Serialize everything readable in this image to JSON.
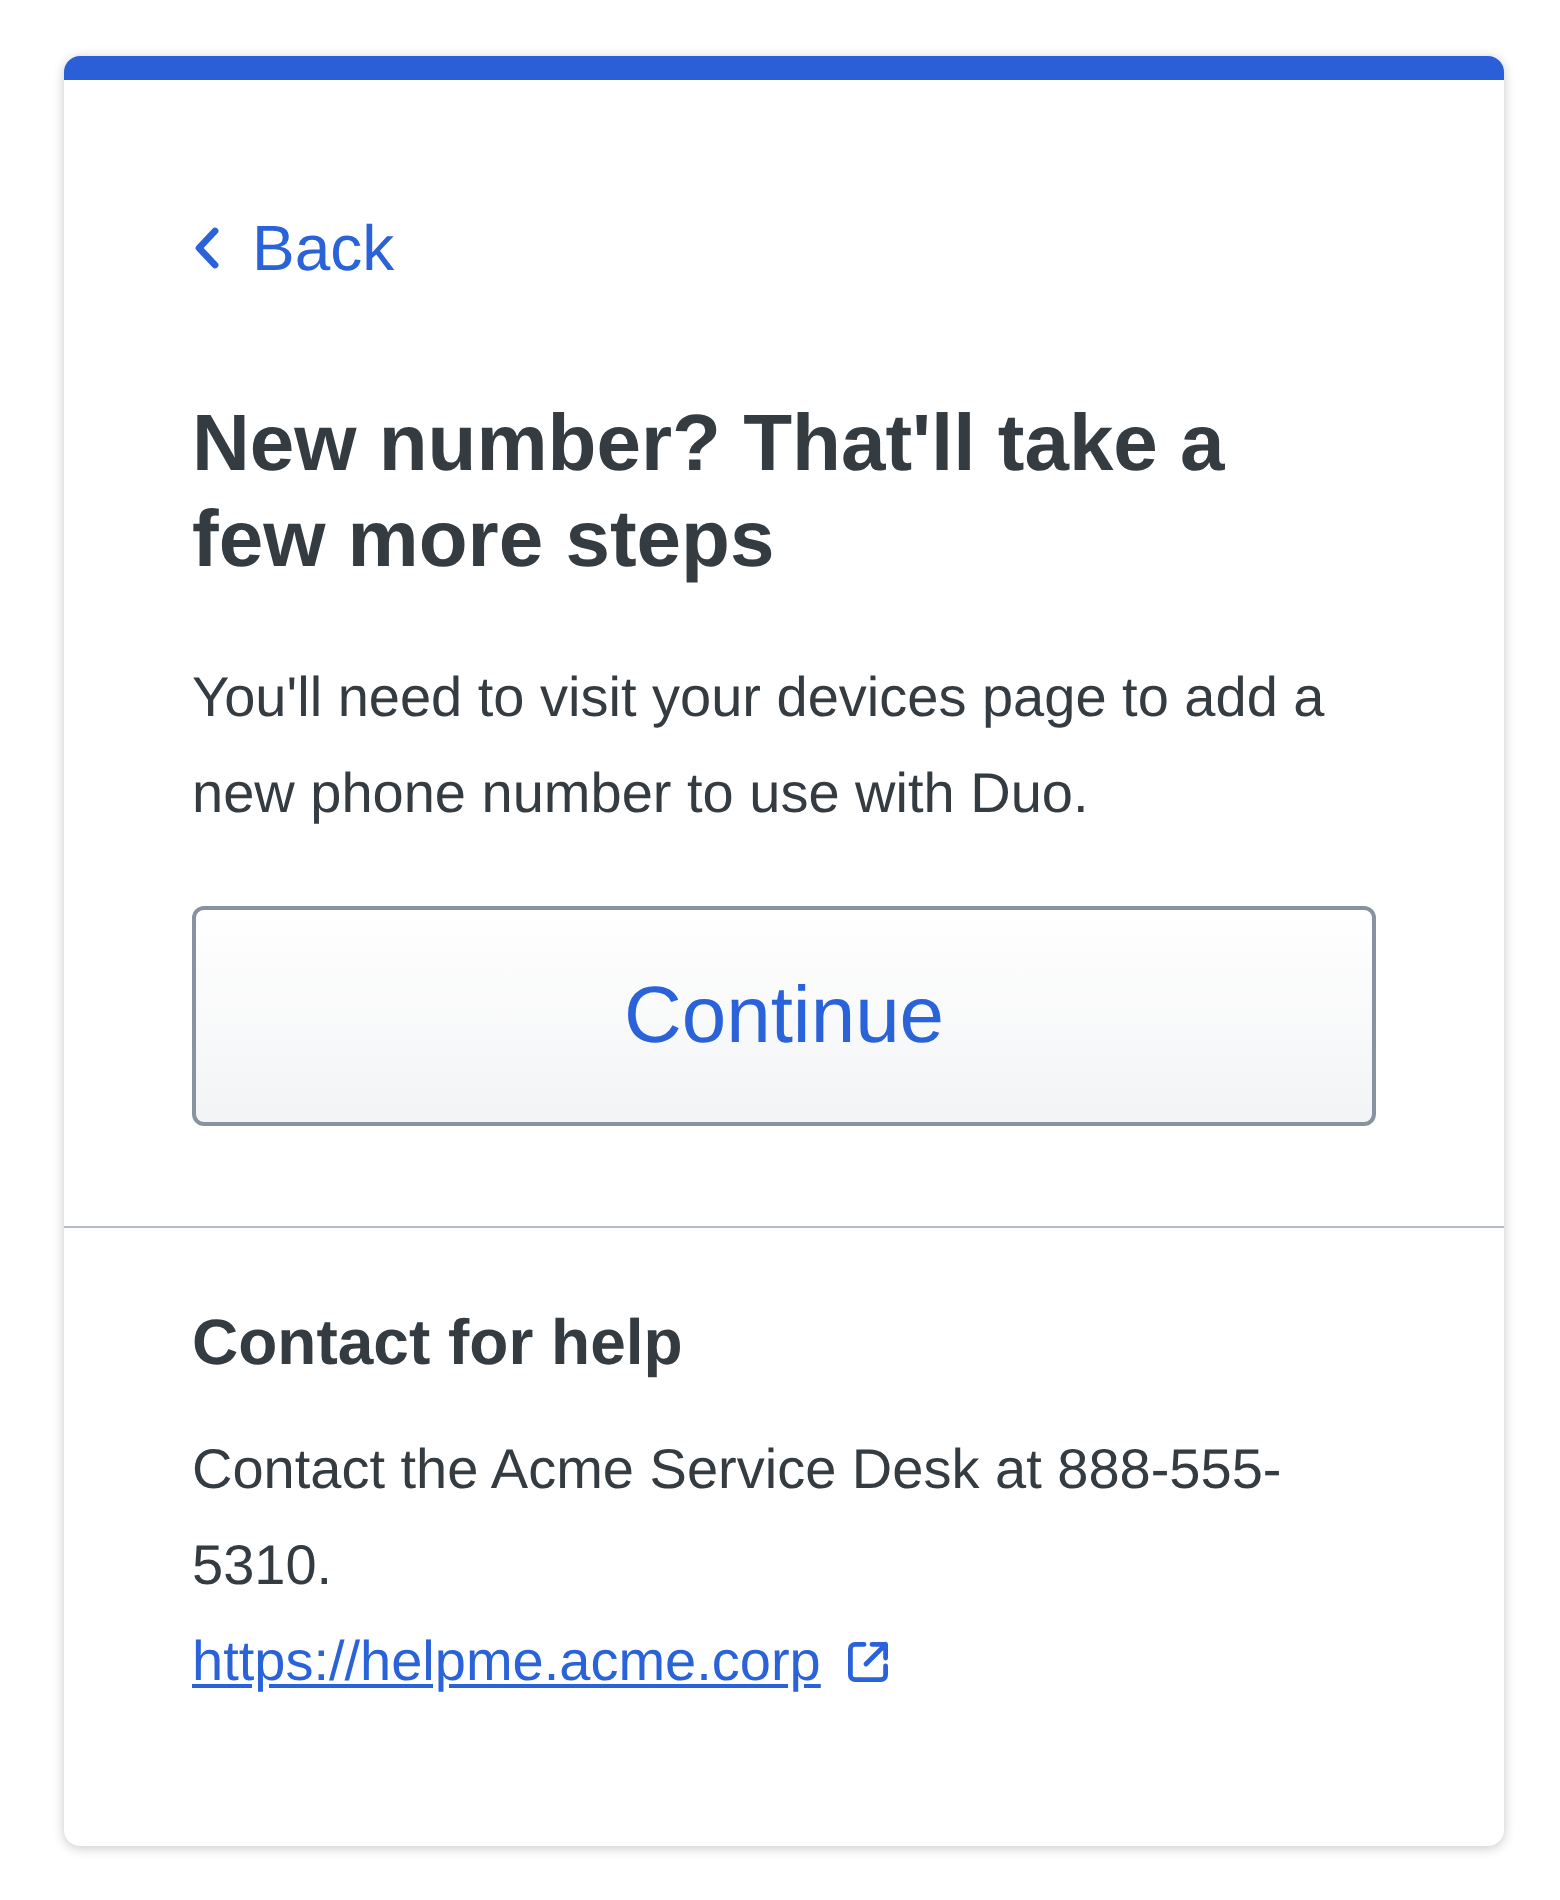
{
  "back_link": {
    "label": "Back"
  },
  "title": "New number? That'll take a few more steps",
  "description": "You'll need to visit your devices page to add a new phone number to use with Duo.",
  "continue_button": {
    "label": "Continue"
  },
  "help": {
    "heading": "Contact for help",
    "text": "Contact the Acme Service Desk at 888-555-5310.",
    "link": {
      "label": "https://helpme.acme.corp"
    }
  }
}
